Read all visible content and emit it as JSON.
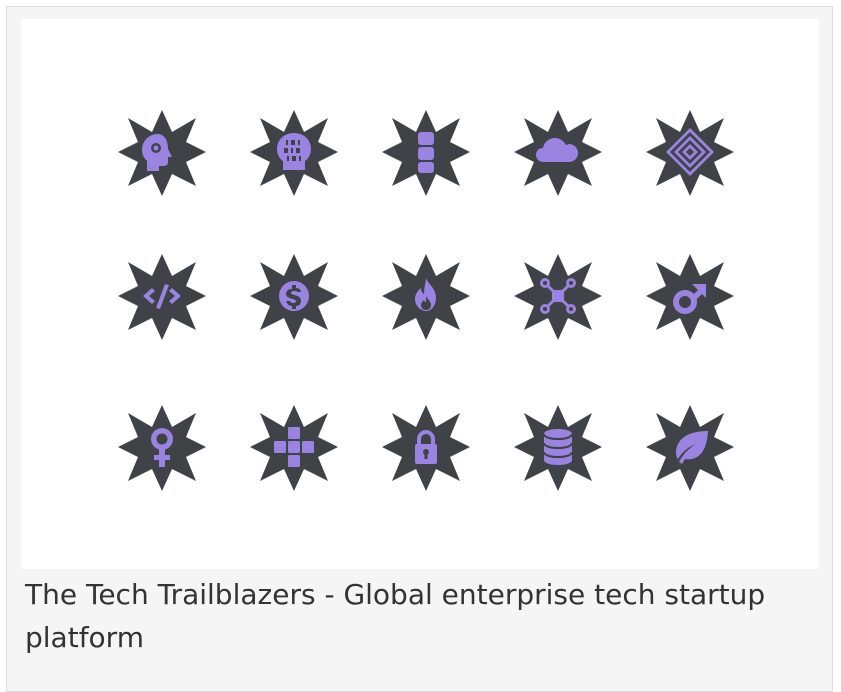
{
  "colors": {
    "badge_fill": "#3f4246",
    "icon_fill": "#9b83e2",
    "caption_text": "#333333"
  },
  "icons": [
    "head-gear-icon",
    "binary-head-icon",
    "server-stack-icon",
    "cloud-icon",
    "layered-diamond-icon",
    "code-brackets-icon",
    "dollar-coin-icon",
    "fire-icon",
    "network-nodes-icon",
    "male-symbol-icon",
    "female-symbol-icon",
    "puzzle-cross-icon",
    "padlock-icon",
    "database-icon",
    "leaf-icon"
  ],
  "caption": "The Tech Trailblazers - Global enterprise tech startup platform"
}
